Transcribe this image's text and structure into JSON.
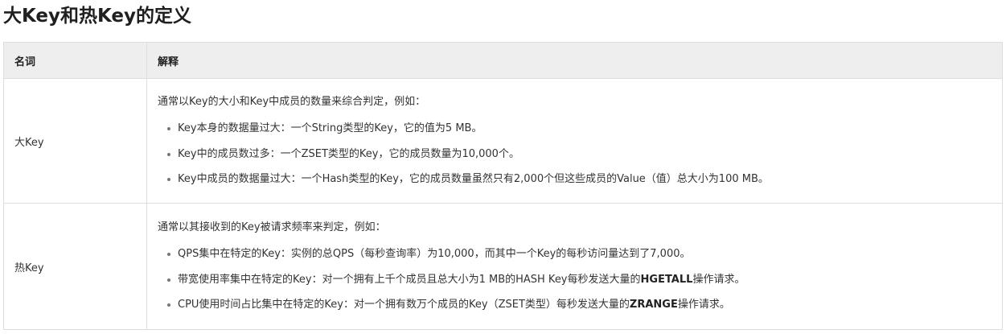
{
  "page": {
    "title": "大Key和热Key的定义"
  },
  "table": {
    "headers": {
      "term": "名词",
      "explanation": "解释"
    },
    "rows": [
      {
        "term": "大Key",
        "intro": "通常以Key的大小和Key中成员的数量来综合判定，例如：",
        "items": [
          {
            "text": "Key本身的数据量过大：一个String类型的Key，它的值为5 MB。"
          },
          {
            "text": "Key中的成员数过多：一个ZSET类型的Key，它的成员数量为10,000个。"
          },
          {
            "text": "Key中成员的数据量过大：一个Hash类型的Key，它的成员数量虽然只有2,000个但这些成员的Value（值）总大小为100 MB。"
          }
        ]
      },
      {
        "term": "热Key",
        "intro": "通常以其接收到的Key被请求频率来判定，例如：",
        "items": [
          {
            "text": "QPS集中在特定的Key：实例的总QPS（每秒查询率）为10,000，而其中一个Key的每秒访问量达到了7,000。"
          },
          {
            "before": "带宽使用率集中在特定的Key：对一个拥有上千个成员且总大小为1 MB的HASH Key每秒发送大量的",
            "bold": "HGETALL",
            "after": "操作请求。"
          },
          {
            "before": "CPU使用时间占比集中在特定的Key：对一个拥有数万个成员的Key（ZSET类型）每秒发送大量的",
            "bold": "ZRANGE",
            "after": "操作请求。"
          }
        ]
      }
    ]
  }
}
